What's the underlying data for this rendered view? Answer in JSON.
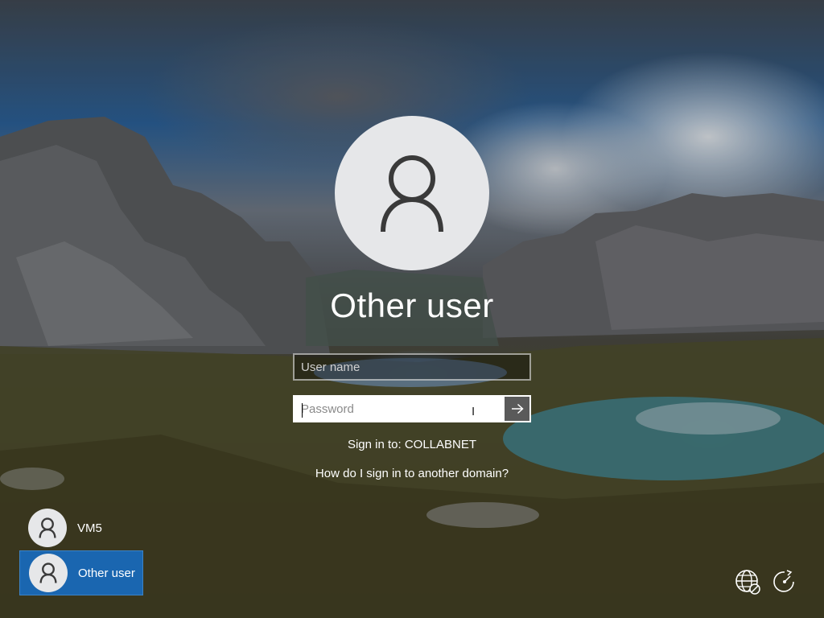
{
  "login": {
    "title": "Other user",
    "username_placeholder": "User name",
    "username_value": "",
    "password_placeholder": "Password",
    "password_value": "",
    "submit_icon": "arrow-right-icon",
    "sign_in_to": "Sign in to: COLLABNET",
    "help_link": "How do I sign in to another domain?"
  },
  "users": [
    {
      "label": "VM5",
      "icon": "user-icon",
      "selected": false
    },
    {
      "label": "Other user",
      "icon": "user-icon",
      "selected": true
    }
  ],
  "system_icons": {
    "network": "network-globe-icon",
    "accessibility": "ease-of-access-icon"
  },
  "colors": {
    "selected_tile": "#1a66b0",
    "avatar_bg": "#e6e7e9",
    "avatar_fg": "#3a3a3a",
    "submit_bg": "#5a5a5a"
  }
}
